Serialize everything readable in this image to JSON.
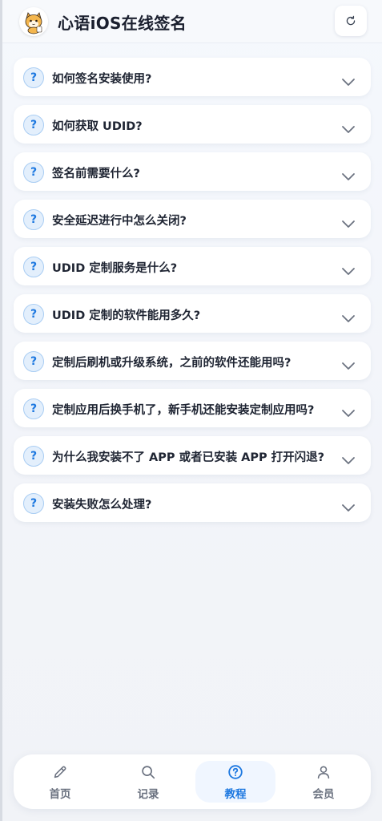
{
  "header": {
    "title": "心语iOS在线签名",
    "logo_icon": "cat-mascot-icon",
    "refresh_icon": "refresh-icon"
  },
  "faq": {
    "badge": "?",
    "items": [
      {
        "question": "如何签名安装使用?"
      },
      {
        "question": "如何获取 UDID?"
      },
      {
        "question": "签名前需要什么?"
      },
      {
        "question": "安全延迟进行中怎么关闭?"
      },
      {
        "question": "UDID 定制服务是什么?"
      },
      {
        "question": "UDID 定制的软件能用多久?"
      },
      {
        "question": "定制后刷机或升级系统，之前的软件还能用吗?"
      },
      {
        "question": "定制应用后换手机了，新手机还能安装定制应用吗?"
      },
      {
        "question": "为什么我安装不了 APP 或者已安装 APP 打开闪退?"
      },
      {
        "question": "安装失败怎么处理?"
      }
    ]
  },
  "nav": {
    "items": [
      {
        "label": "首页",
        "icon": "pencil-icon"
      },
      {
        "label": "记录",
        "icon": "search-icon"
      },
      {
        "label": "教程",
        "icon": "help-circle-icon",
        "active": true
      },
      {
        "label": "会员",
        "icon": "user-icon"
      }
    ]
  },
  "colors": {
    "accent": "#1d78e0",
    "text": "#1f2533",
    "muted": "#6b7280"
  }
}
